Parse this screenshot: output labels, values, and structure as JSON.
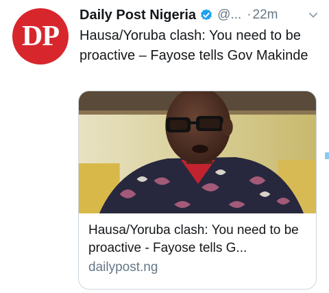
{
  "tweet": {
    "avatar_text": "DP",
    "display_name": "Daily Post Nigeria",
    "handle": "@...",
    "separator": "·",
    "time": "22m",
    "text": "Hausa/Yoruba clash: You need to be proactive – Fayose tells Gov Makinde"
  },
  "card": {
    "title": "Hausa/Yoruba clash: You need to be proactive - Fayose tells G...",
    "domain": "dailypost.ng"
  },
  "icons": {
    "verified": "verified-badge-icon",
    "more": "chevron-down-icon"
  },
  "colors": {
    "brand_red": "#d8262d",
    "verified_blue": "#1da1f2",
    "secondary_text": "#657786",
    "card_border": "#ccd6dd"
  }
}
